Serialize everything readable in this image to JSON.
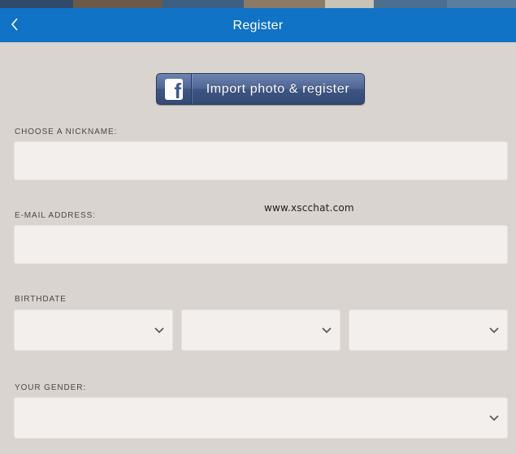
{
  "app": {
    "photo_strip_colors": [
      "#2f4a6b",
      "#6b5a48",
      "#3c5f84",
      "#8a7a66",
      "#4d6f8f",
      "#c9c2b6",
      "#5b7da0"
    ]
  },
  "header": {
    "title": "Register",
    "back_icon": "chevron-left-icon",
    "background": "#1073c6"
  },
  "facebook": {
    "logo_letter": "f",
    "label": "Import photo & register"
  },
  "form": {
    "nickname": {
      "label": "CHOOSE A NICKNAME:",
      "value": "",
      "placeholder": ""
    },
    "email": {
      "label": "E-MAIL ADDRESS:",
      "value": "",
      "placeholder": ""
    },
    "birthdate": {
      "label": "BIRTHDATE",
      "day": "",
      "month": "",
      "year": ""
    },
    "gender": {
      "label": "YOUR GENDER:",
      "value": ""
    }
  },
  "watermark": "www.xscchat.com"
}
